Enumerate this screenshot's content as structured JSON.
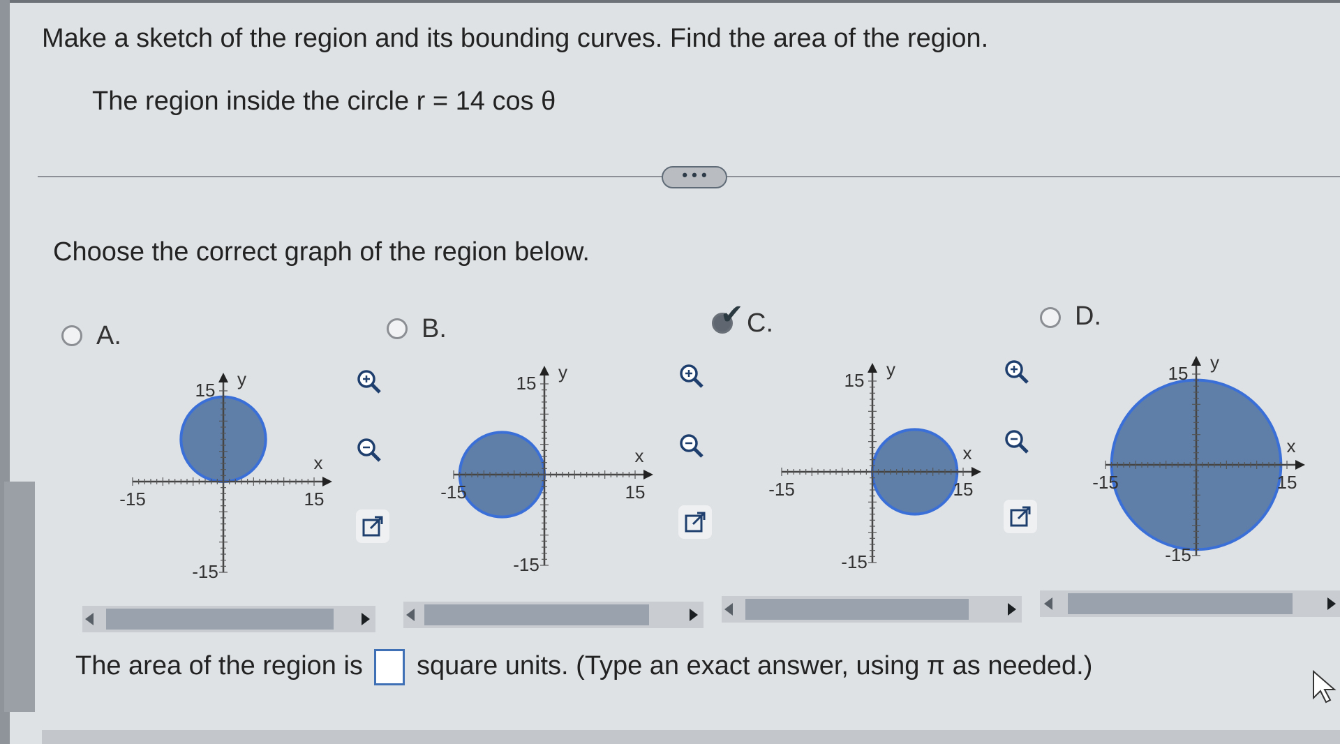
{
  "question": {
    "prompt": "Make a sketch of the region and its bounding curves. Find the area of the region.",
    "region_description": "The region inside the circle r = 14 cos θ",
    "more_button_label": "• • •",
    "choose_prompt": "Choose the correct graph of the region below."
  },
  "options": [
    {
      "letter": "A.",
      "selected": false,
      "graph": {
        "circle_center": [
          0,
          7
        ],
        "circle_radius": 7
      }
    },
    {
      "letter": "B.",
      "selected": false,
      "graph": {
        "circle_center": [
          -7,
          0
        ],
        "circle_radius": 7
      }
    },
    {
      "letter": "C.",
      "selected": true,
      "graph": {
        "circle_center": [
          7,
          0
        ],
        "circle_radius": 7
      }
    },
    {
      "letter": "D.",
      "selected": false,
      "graph": {
        "circle_center": [
          0,
          0
        ],
        "circle_radius": 14
      }
    }
  ],
  "graph_axes": {
    "x_label": "x",
    "y_label": "y",
    "x_min_label": "-15",
    "x_max_label": "15",
    "y_min_label": "-15",
    "y_max_label": "15",
    "range": [
      -15,
      15
    ]
  },
  "tools": {
    "zoom_in": "zoom-in-icon",
    "zoom_out": "zoom-out-icon",
    "open_new": "open-in-new-window-icon"
  },
  "answer": {
    "prefix": "The area of the region is",
    "value": "",
    "suffix": "square units. (Type an exact answer, using π as needed.)"
  },
  "colors": {
    "region_fill": "#5f7fa8",
    "region_stroke": "#3a6fd8",
    "axis": "#444444"
  }
}
